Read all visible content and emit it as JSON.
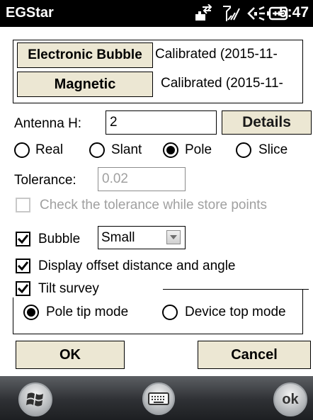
{
  "titlebar": {
    "app_title": "EGStar",
    "clock": "5:47",
    "icons": [
      "network-icon",
      "signal-icon",
      "speaker-icon",
      "battery-icon"
    ]
  },
  "calibration": {
    "electronic_bubble_button": "Electronic Bubble",
    "electronic_bubble_status": "Calibrated (2015-11-",
    "magnetic_button": "Magnetic",
    "magnetic_status": "Calibrated (2015-11-"
  },
  "antenna": {
    "label": "Antenna H:",
    "value": "2",
    "details_button": "Details"
  },
  "height_type": {
    "options": [
      "Real",
      "Slant",
      "Pole",
      "Slice"
    ],
    "selected": "Pole"
  },
  "tolerance": {
    "label": "Tolerance:",
    "value": "0.02",
    "check_label": "Check the tolerance while store points",
    "checked": false,
    "enabled": false
  },
  "bubble": {
    "label": "Bubble",
    "checked": true,
    "size_value": "Small"
  },
  "display_offset": {
    "label": "Display offset distance and angle",
    "checked": true
  },
  "tilt_survey": {
    "label": "Tilt survey",
    "checked": true,
    "modes": [
      "Pole tip mode",
      "Device top mode"
    ],
    "selected": "Pole tip mode"
  },
  "actions": {
    "ok": "OK",
    "cancel": "Cancel"
  },
  "taskbar": {
    "start_icon": "windows-start-icon",
    "keyboard_icon": "keyboard-icon",
    "ok_label": "ok"
  },
  "colors": {
    "titlebar": "#000000",
    "button_face": "#ece7d3",
    "disabled_text": "#a0a0a0",
    "taskbar": "#2e3034"
  }
}
